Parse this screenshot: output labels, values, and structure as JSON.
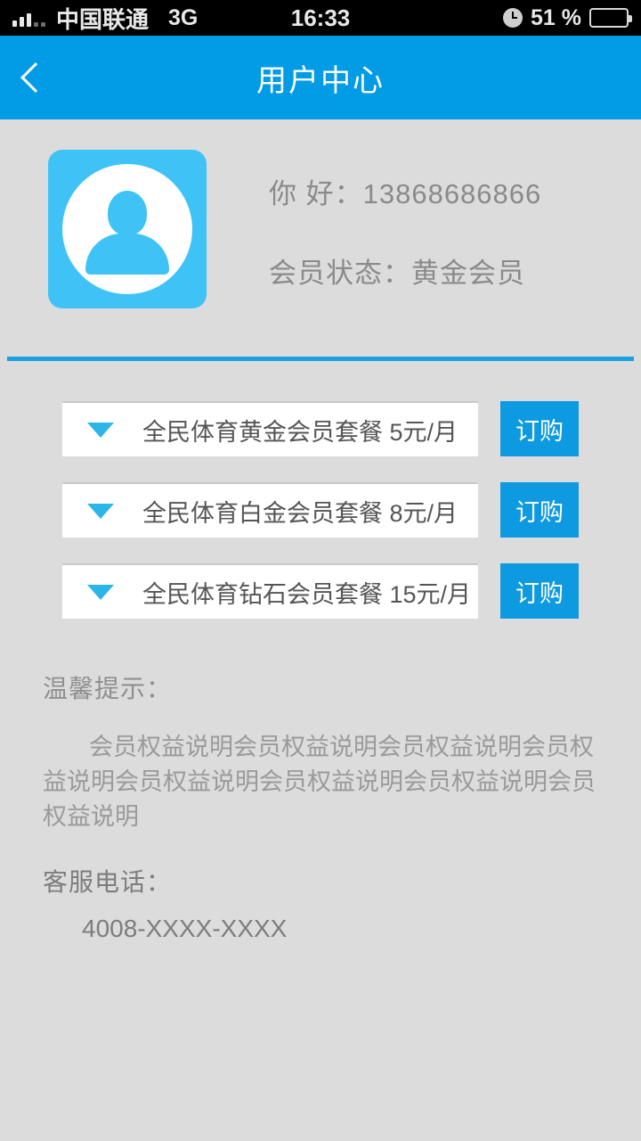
{
  "status_bar": {
    "carrier": "中国联通",
    "network": "3G",
    "time": "16:33",
    "battery_percent": "51 %",
    "signal_icon": "signal-bars-icon",
    "clock_icon": "clock-icon",
    "battery_icon": "battery-icon"
  },
  "nav": {
    "title": "用户中心",
    "back_icon": "chevron-left-icon"
  },
  "profile": {
    "avatar_icon": "person-avatar-icon",
    "greeting": "你  好：13868686866",
    "member_status": "会员状态：黄金会员"
  },
  "packages": [
    {
      "label": "全民体育黄金会员套餐  5元/月",
      "order_label": "订购",
      "arrow_icon": "triangle-down-icon"
    },
    {
      "label": "全民体育白金会员套餐  8元/月",
      "order_label": "订购",
      "arrow_icon": "triangle-down-icon"
    },
    {
      "label": "全民体育钻石会员套餐 15元/月",
      "order_label": "订购",
      "arrow_icon": "triangle-down-icon"
    }
  ],
  "notes": {
    "tips_title": "温馨提示：",
    "tips_body": "会员权益说明会员权益说明会员权益说明会员权益说明会员权益说明会员权益说明会员权益说明会员权益说明",
    "service_title": "客服电话：",
    "service_phone": "4008-XXXX-XXXX"
  },
  "colors": {
    "nav_blue": "#029be5",
    "button_blue": "#0d9ae0",
    "avatar_blue": "#3fc3f7",
    "divider_blue": "#1aa3e0",
    "background_gray": "#dcdcdc"
  }
}
